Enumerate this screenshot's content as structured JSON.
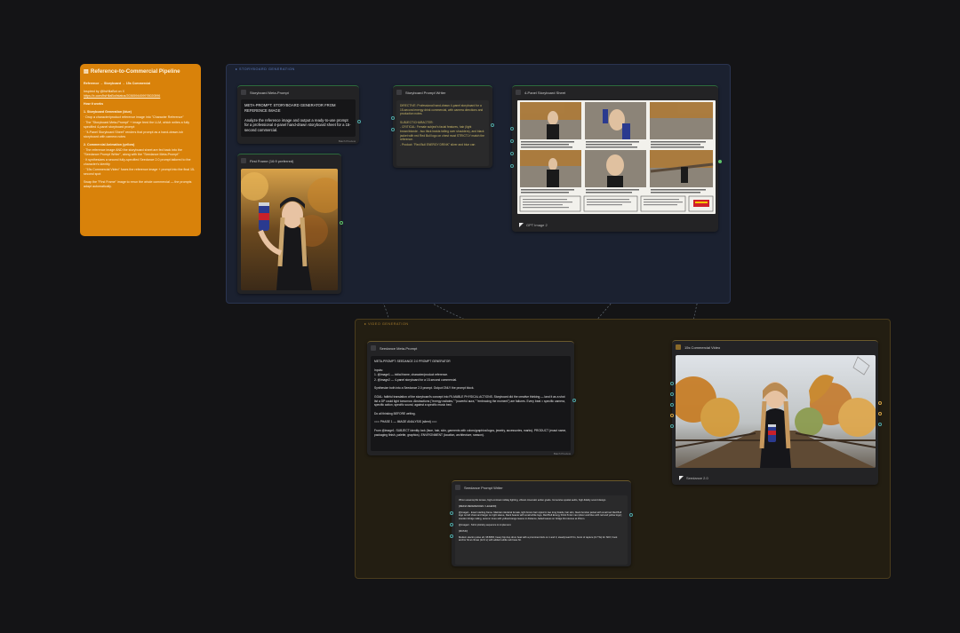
{
  "note": {
    "title": "Reference-to-Commercial Pipeline",
    "subtitle": "Reference → Storyboard → 15s Commercial",
    "inspired_by": "Inspired by @ItsHilaBot on X",
    "link": "https://x.com/ItsHilaBot/status/2036594459978020596",
    "how_it_works": "How it works",
    "step1_title": "1. Storyboard Generation (blue)",
    "step1_lines": [
      "· Drop a character/product reference image into \"Character Reference\"",
      "· The \"Storyboard Meta-Prompt\" + image feed the LLM, which writes a fully specified 4-panel storyboard prompt",
      "· \"4-Panel Storyboard Sheet\" renders that prompt as a hand-drawn-ish storyboard with camera notes"
    ],
    "step2_title": "2. Commercial Animation (yellow)",
    "step2_lines": [
      "· The reference image AND the storyboard sheet are fed back into the \"Seedance Prompt Writer\", along with the \"Seedance Meta-Prompt\"",
      "· It synthesizes a second fully-specified Seedance 2.0 prompt tailored to the character's identity",
      "· \"15s Commercial Video\" fuses the reference image + prompt into the final 15-second spot"
    ],
    "closing": "Swap the \"First Frame\" image to rerun the whole commercial — the prompts adapt automatically."
  },
  "groups": {
    "blue_title": "STORYBOARD GENERATION",
    "yellow_title": "VIDEO GENERATION"
  },
  "nodes": {
    "sb_meta": {
      "title": "Storyboard Meta-Prompt",
      "line1": "META-PROMPT: STORYBOARD GENERATOR FROM REFERENCE IMAGE",
      "line2": "Analyze the reference image and output a ready-to-use prompt for a professional 4-panel hand-drawn storyboard sheet for a 15-second commercial.",
      "footer": "Batch Preview"
    },
    "first_frame": {
      "title": "First Frame (16:9 preferred)"
    },
    "sb_writer": {
      "title": "Storyboard Prompt Writer",
      "p1": "DIRECTIVE: Professional hand-drawn 4-panel storyboard for a 15-second energy drink commercial, with camera directions and production notes.",
      "p2": "SUBJECT/CHARACTER:",
      "p3": "- CRITICAL: Female subject's facial features, hair (light brown/blonde - two thick braids falling over shoulders), and black jacket with red Red Bull logo on chest must STRICTLY match the reference.",
      "p4": "- Product: \"Red Bull ENERGY DRINK\" silver and blue can"
    },
    "sheet": {
      "title": "4-Panel Storyboard Sheet",
      "footer": "GPT Image 2"
    },
    "seed_meta": {
      "title": "Seedance Meta-Prompt",
      "p1": "META-PROMPT: SEEDANCE 2.0 PROMPT GENERATOR",
      "p2": "Inputs:",
      "p3": "1. @image1 — initial frame, character/product reference.",
      "p4": "2. @image2 — 4-panel storyboard for a 15-second commercial.",
      "p5": "Synthesize both into a Seedance 2.0 prompt. Output ONLY the prompt block.",
      "p6": "GOAL: faithful translation of the storyboard's concept into FILMABLE PHYSICAL ACTIONS. Storyboard did the creative thinking — land it as a shot list a DP could light tomorrow. Abstractions (\"energy radiates,\" \"powerful aura,\" \"embracing the moment\") are failures. Every beat = specific camera, specific action, specific sound, against a specific music bed.",
      "p7": "Do all thinking BEFORE writing.",
      "p8": "=== PHASE 1 — IMAGE ANALYSIS (silent) ===",
      "p9": "From @image1: SUBJECT identity lock (face, hair, skin, garments with colors/graphics/logos, jewelry, accessories, marks). PRODUCT (exact name, packaging finish, palette, graphics). ENVIRONMENT (location, architecture, season).",
      "footer": "Batch Preview"
    },
    "seed_writer": {
      "title": "Seedance Prompt Writer",
      "p1": "35mm anamorphic lenses, high-contrast midday lighting, vibrant cinematic action grade. Immersive spatial audio, high-fidelity sound design.",
      "p2": "[MEDIA REFERENCES / LEGEND]",
      "p3": "@image1 - Exact starting frame. Maintain identical female, light brown hair styled in two long braids, hair skin, black bomber jacket with small red Red Bull logo on left chest and larger on right sleeve, black beanie with small white logo, Red Bull Energy Drink 8.4oz can (silver and blue with red and yellow logo); wooden bridge railing, autumn trees with yellow/orange leaves in distance, faded leaves on bridge first stones at 45mm.",
      "p4": "@image2 - Strict plot/sky sequence to implement.",
      "p5": "[MUSIC]",
      "p6": "Modern electro pulse eft, 98 BPM, heavy hip-hop drum beat with a prominent kick on 1 and 3, steady lead 8 fm, burst of rapture (0.7 5s) for SFX; hook anchor hit at climax (12.0 s) with added subtle sub bass hit."
    },
    "video": {
      "title": "15s Commercial Video",
      "footer": "Seedance 2.0"
    }
  }
}
